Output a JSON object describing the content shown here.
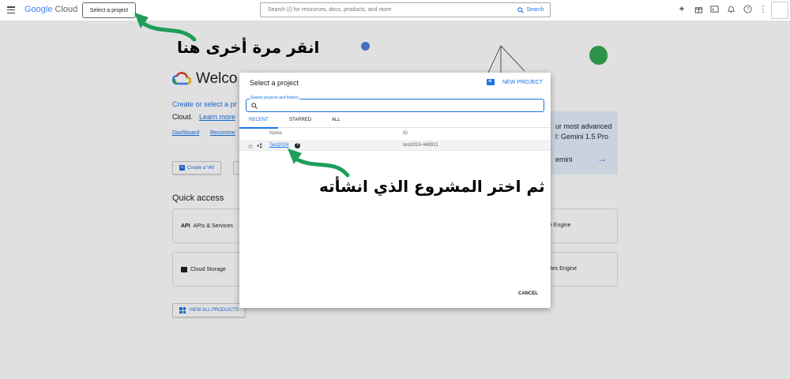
{
  "topbar": {
    "logo_google": "Google",
    "logo_cloud": "Cloud",
    "project_button": "Select a project",
    "search_placeholder": "Search (/) for resources, docs, products, and more",
    "search_button": "Search"
  },
  "dashboard": {
    "welcome_title": "Welco",
    "intro_line1": "Create or select a pr",
    "intro_line2": "Cloud.",
    "intro_link": "Learn more",
    "tab_dashboard": "Dashboard",
    "tab_recommendations": "Recomme",
    "create_vm": "Create a VM",
    "quick_access": "Quick access",
    "qa_apis": "APIs & Services",
    "qa_storage": "Cloud Storage",
    "qa_right_top": "te Engine",
    "qa_right_bottom": "etes Engine",
    "gemini_line1": "ur most advanced",
    "gemini_line2": "l: Gemini 1.5 Pro",
    "gemini_line3": "emini",
    "view_all": "VIEW ALL PRODUCTS"
  },
  "dialog": {
    "title": "Select a project",
    "new_project": "NEW PROJECT",
    "search_label": "Search projects and folders",
    "tabs": [
      "RECENT",
      "STARRED",
      "ALL"
    ],
    "columns": {
      "name": "Name",
      "id": "ID"
    },
    "rows": [
      {
        "name": "Test2024",
        "id": "test2024-448911"
      }
    ],
    "cancel": "CANCEL"
  },
  "annotations": {
    "step1": "انقر مرة أخرى هنا",
    "step2": "ثم اختر المشروع الذي انشأته"
  },
  "colors": {
    "accent": "#1a73e8",
    "arrow": "#1e9e5a"
  }
}
